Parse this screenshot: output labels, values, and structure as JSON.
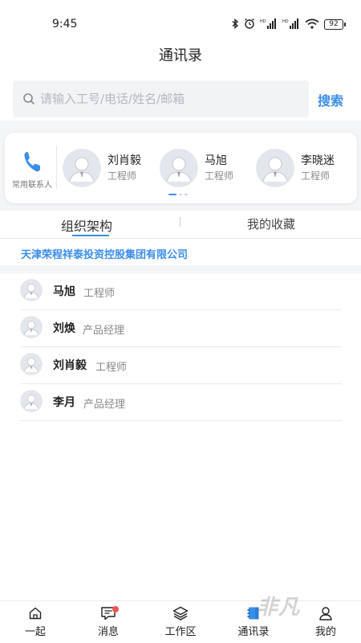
{
  "status_bar": {
    "time": "9:45",
    "battery": "92"
  },
  "header": {
    "title": "通讯录"
  },
  "search": {
    "placeholder": "请输入工号/电话/姓名/邮箱",
    "value": "",
    "button_label": "搜索"
  },
  "frequent": {
    "label": "常用联系人",
    "contacts": [
      {
        "name": "刘肖毅",
        "title": "工程师"
      },
      {
        "name": "马旭",
        "title": "工程师"
      },
      {
        "name": "李晓迷",
        "title": "工程师"
      }
    ],
    "page_count": 3,
    "active_page": 0
  },
  "tabs": [
    {
      "label": "组织架构",
      "active": true
    },
    {
      "label": "我的收藏",
      "active": false
    }
  ],
  "company": {
    "name": "天津荣程祥泰投资控股集团有限公司"
  },
  "members": [
    {
      "name": "马旭",
      "title": "工程师"
    },
    {
      "name": "刘焕",
      "title": "产品经理"
    },
    {
      "name": "刘肖毅",
      "title": "工程师"
    },
    {
      "name": "李月",
      "title": "产品经理"
    }
  ],
  "nav": [
    {
      "label": "一起",
      "icon": "home-icon"
    },
    {
      "label": "消息",
      "icon": "message-icon",
      "badge": true
    },
    {
      "label": "工作区",
      "icon": "layers-icon"
    },
    {
      "label": "通讯录",
      "icon": "contacts-icon",
      "active": true
    },
    {
      "label": "我的",
      "icon": "user-icon"
    }
  ],
  "watermark": "非凡软件站",
  "colors": {
    "accent": "#3b8ee8",
    "badge": "#f25555",
    "background": "#f4f5f7"
  }
}
